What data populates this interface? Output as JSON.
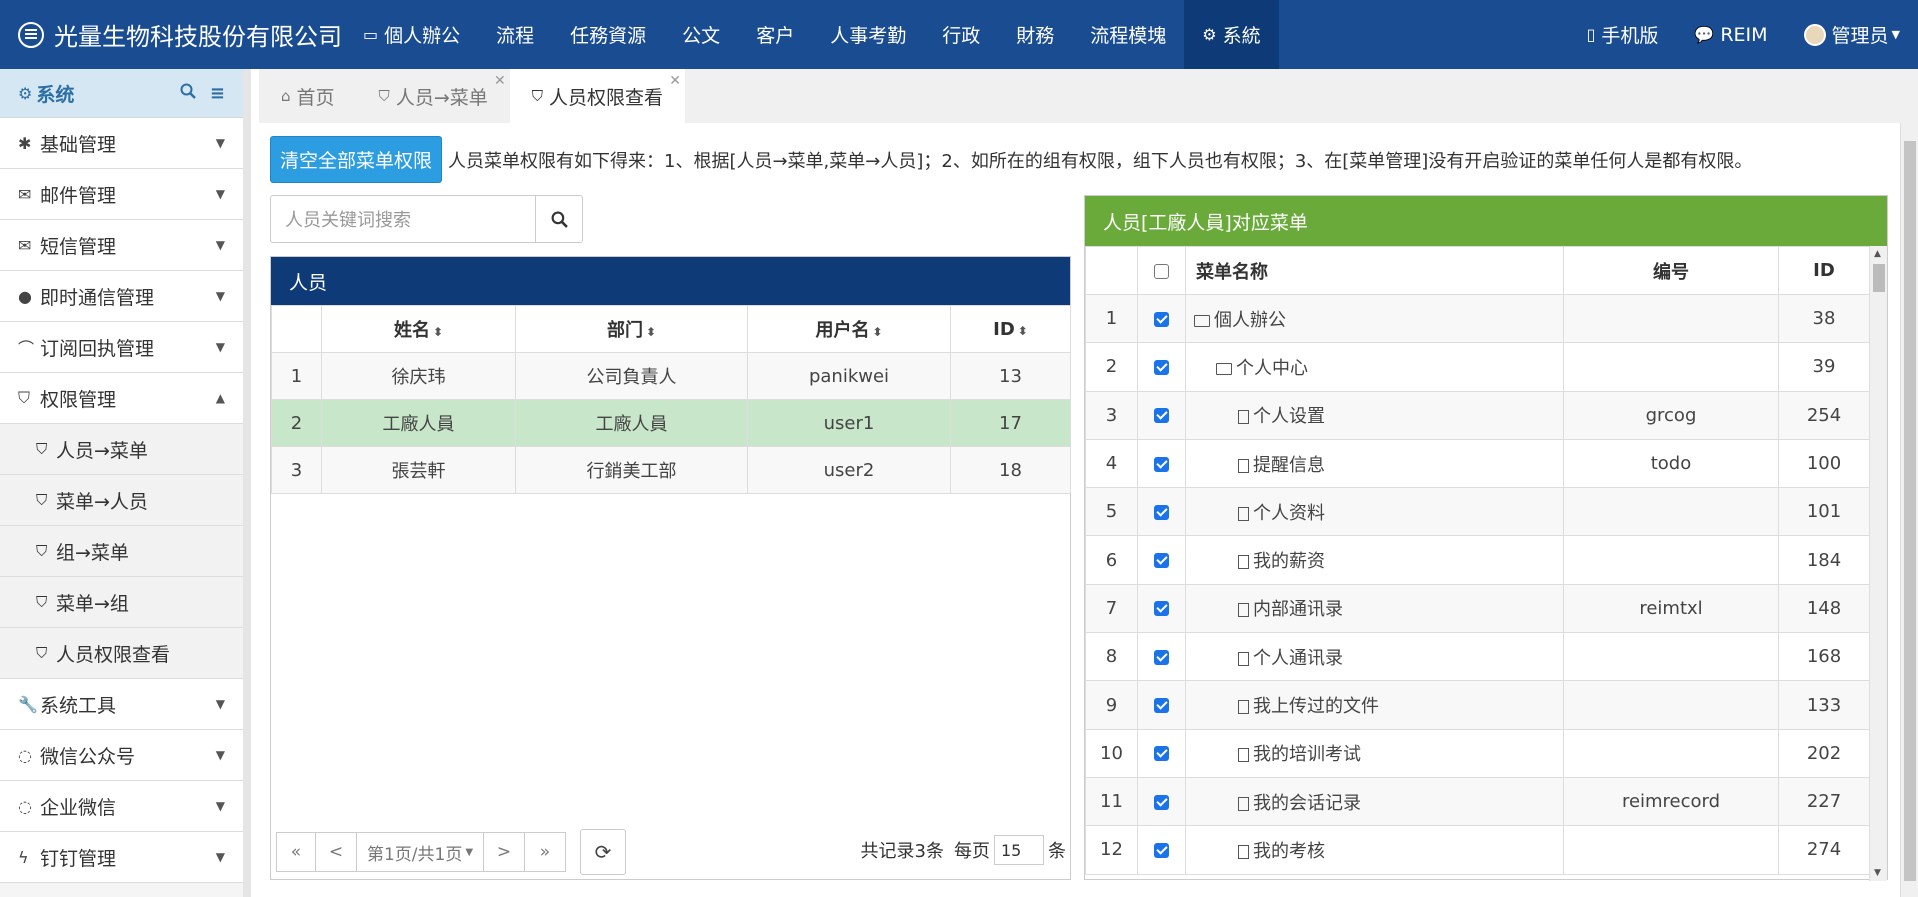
{
  "header": {
    "brand": "光量生物科技股份有限公司",
    "nav": [
      "個人辦公",
      "流程",
      "任務資源",
      "公文",
      "客户",
      "人事考勤",
      "行政",
      "財務",
      "流程模塊",
      "系統"
    ],
    "right": {
      "mobile": "手机版",
      "reim": "REIM",
      "user": "管理员"
    }
  },
  "sidebar": {
    "title": "系统",
    "items": [
      "基础管理",
      "邮件管理",
      "短信管理",
      "即时通信管理",
      "订阅回执管理",
      "权限管理"
    ],
    "sub_items": [
      "人员→菜单",
      "菜单→人员",
      "组→菜单",
      "菜单→组",
      "人员权限查看"
    ],
    "bottom_items": [
      "系统工具",
      "微信公众号",
      "企业微信",
      "钉钉管理"
    ]
  },
  "tabs": [
    "首页",
    "人员→菜单",
    "人员权限查看"
  ],
  "toolbar": {
    "clear_button": "清空全部菜单权限",
    "notice": "人员菜单权限有如下得来：1、根据[人员→菜单,菜单→人员]；2、如所在的组有权限，组下人员也有权限；3、在[菜单管理]没有开启验证的菜单任何人是都有权限。",
    "search_placeholder": "人员关键词搜索"
  },
  "users_panel": {
    "title": "人员",
    "columns": [
      "姓名",
      "部门",
      "用户名",
      "ID"
    ],
    "rows": [
      {
        "n": "1",
        "name": "徐庆玮",
        "dept": "公司負責人",
        "user": "panikwei",
        "id": "13"
      },
      {
        "n": "2",
        "name": "工廠人員",
        "dept": "工廠人員",
        "user": "user1",
        "id": "17"
      },
      {
        "n": "3",
        "name": "張芸軒",
        "dept": "行銷美工部",
        "user": "user2",
        "id": "18"
      }
    ],
    "pager": {
      "first": "«",
      "prev": "<",
      "page": "第1页/共1页",
      "next": ">",
      "last": "»",
      "total": "共记录3条",
      "per_label": "每页",
      "per_value": "15",
      "per_unit": "条"
    }
  },
  "menu_panel": {
    "title": "人员[工廠人員]对应菜单",
    "columns": [
      "菜单名称",
      "编号",
      "ID"
    ],
    "rows": [
      {
        "n": "1",
        "name": "個人辦公",
        "code": "",
        "id": "38",
        "level": 0,
        "type": "folder"
      },
      {
        "n": "2",
        "name": "个人中心",
        "code": "",
        "id": "39",
        "level": 1,
        "type": "folder"
      },
      {
        "n": "3",
        "name": "个人设置",
        "code": "grcog",
        "id": "254",
        "level": 2,
        "type": "file"
      },
      {
        "n": "4",
        "name": "提醒信息",
        "code": "todo",
        "id": "100",
        "level": 2,
        "type": "file"
      },
      {
        "n": "5",
        "name": "个人资料",
        "code": "",
        "id": "101",
        "level": 2,
        "type": "file"
      },
      {
        "n": "6",
        "name": "我的薪资",
        "code": "",
        "id": "184",
        "level": 2,
        "type": "file"
      },
      {
        "n": "7",
        "name": "内部通讯录",
        "code": "reimtxl",
        "id": "148",
        "level": 2,
        "type": "file"
      },
      {
        "n": "8",
        "name": "个人通讯录",
        "code": "",
        "id": "168",
        "level": 2,
        "type": "file"
      },
      {
        "n": "9",
        "name": "我上传过的文件",
        "code": "",
        "id": "133",
        "level": 2,
        "type": "file"
      },
      {
        "n": "10",
        "name": "我的培训考试",
        "code": "",
        "id": "202",
        "level": 2,
        "type": "file"
      },
      {
        "n": "11",
        "name": "我的会话记录",
        "code": "reimrecord",
        "id": "227",
        "level": 2,
        "type": "file"
      },
      {
        "n": "12",
        "name": "我的考核",
        "code": "",
        "id": "274",
        "level": 2,
        "type": "file"
      }
    ]
  }
}
